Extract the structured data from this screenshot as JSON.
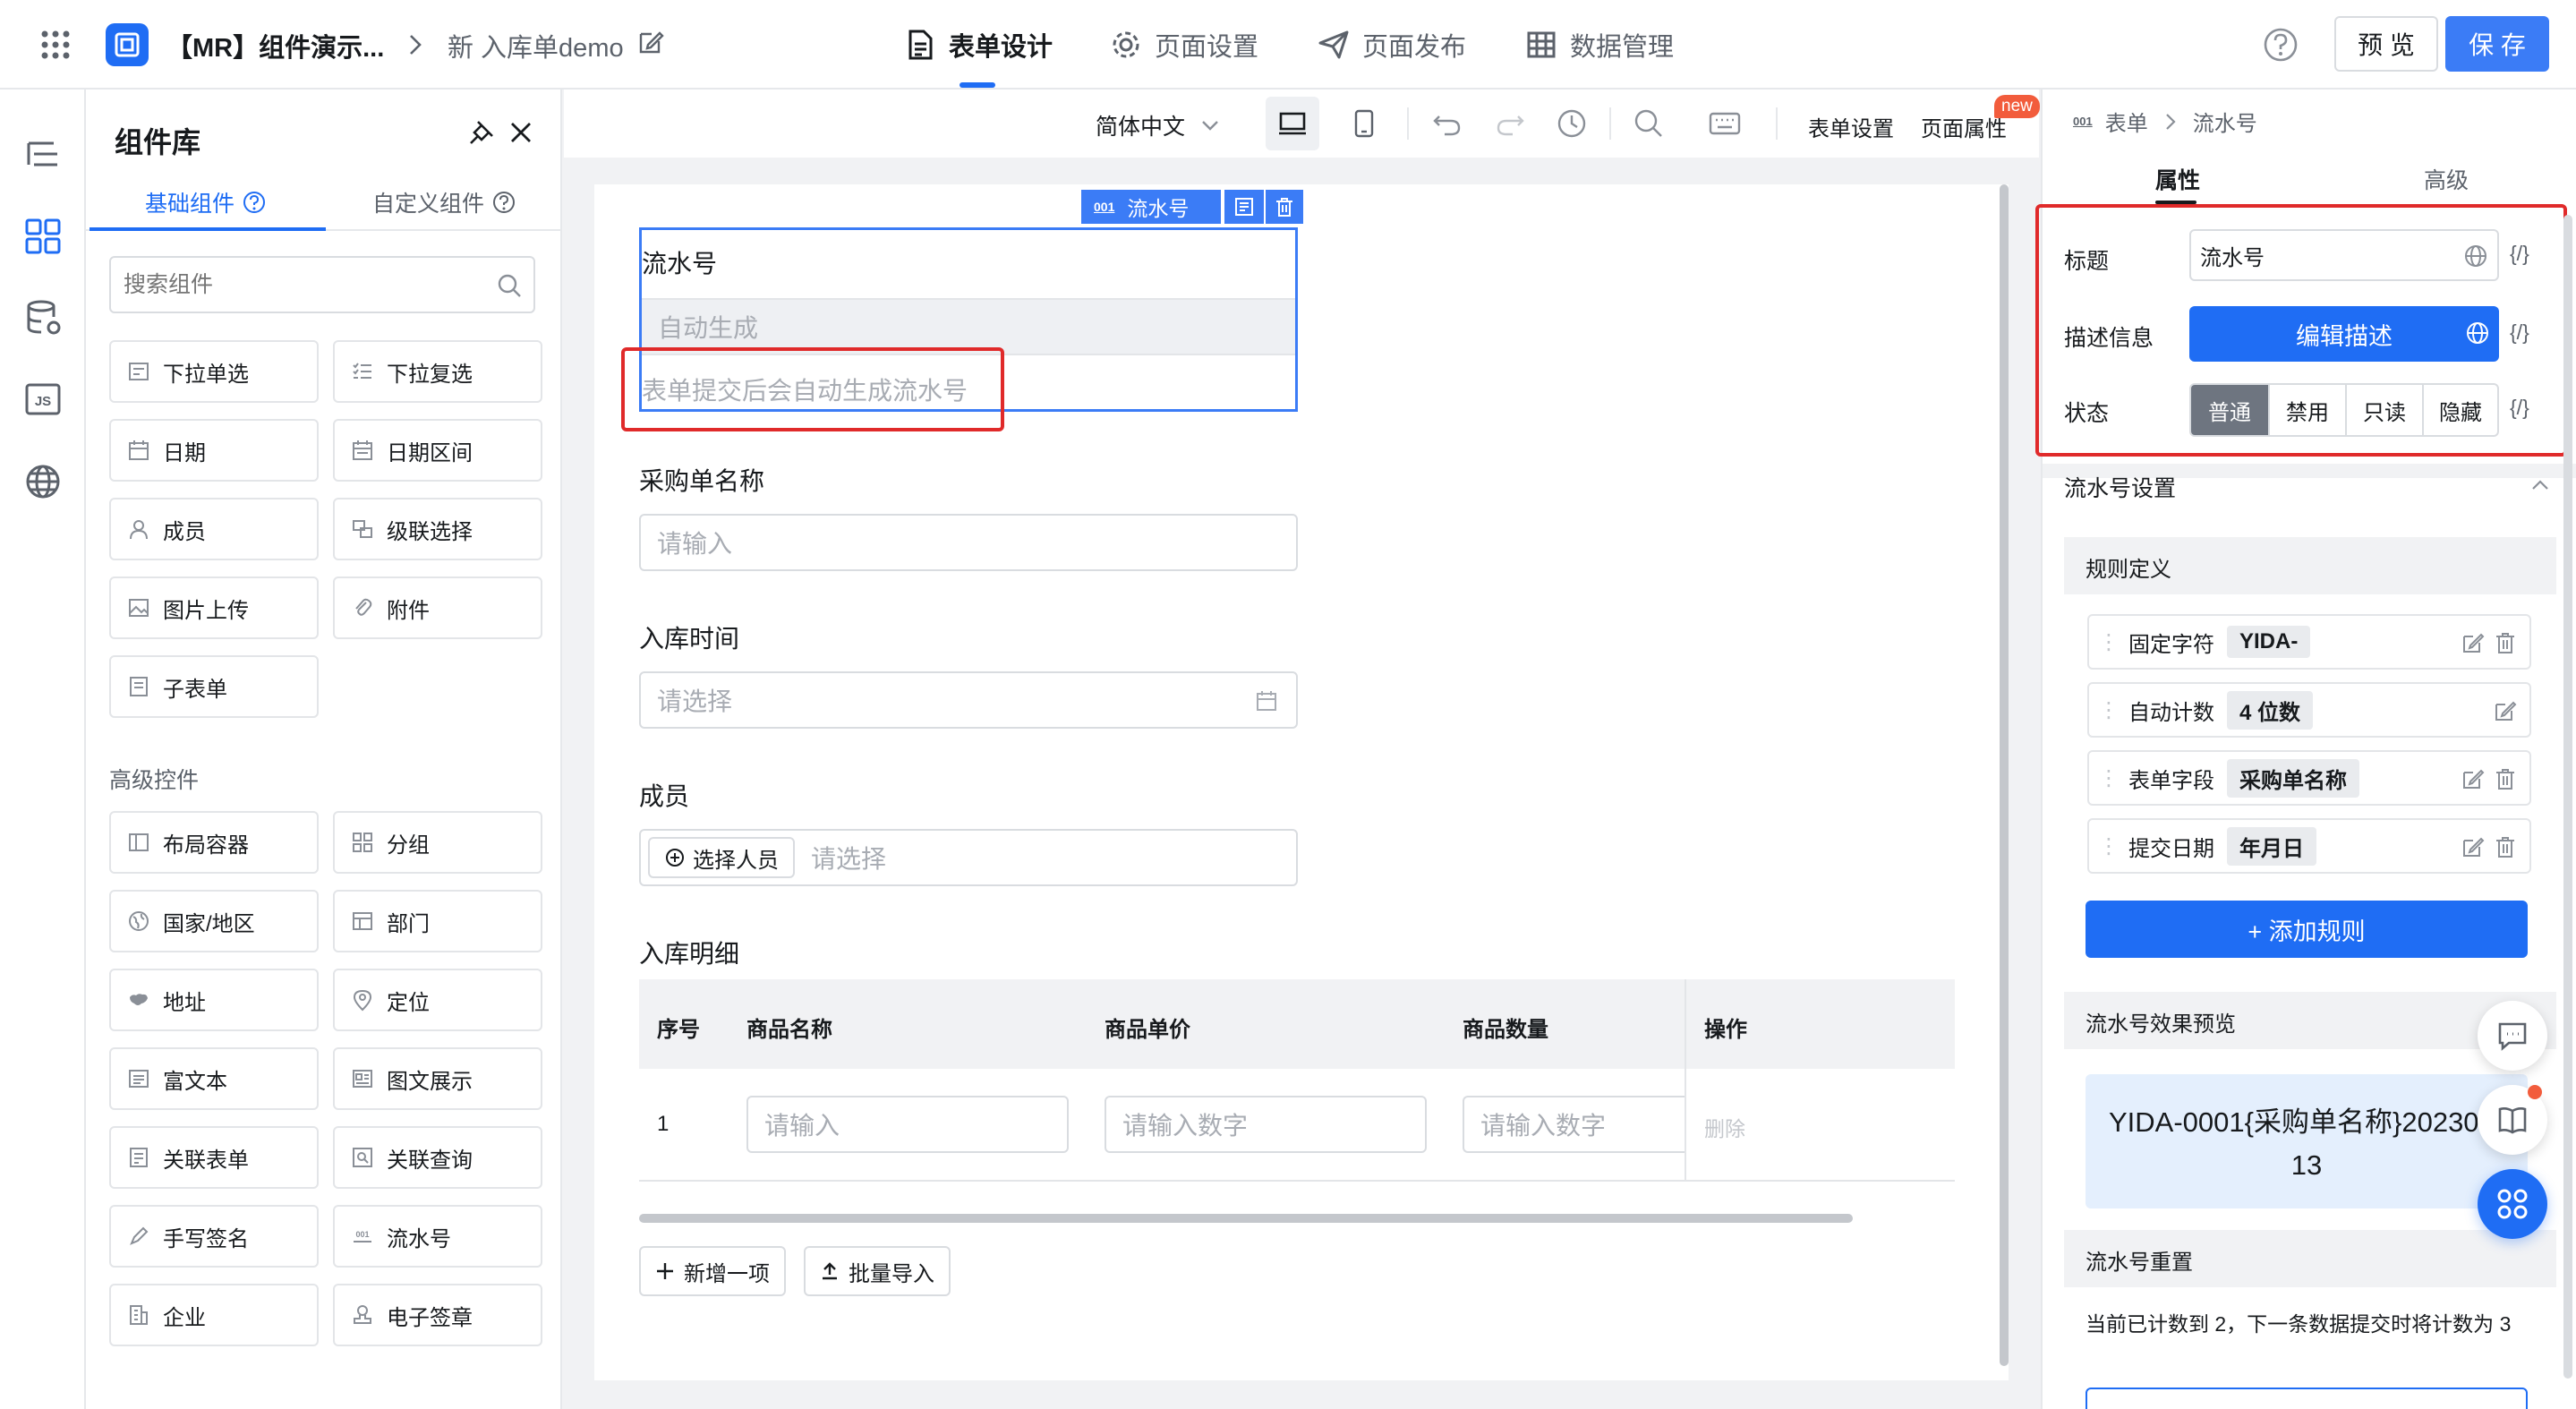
{
  "header": {
    "app_name": "【MR】组件演示...",
    "page_name": "新 入库单demo",
    "tabs": [
      {
        "label": "表单设计"
      },
      {
        "label": "页面设置"
      },
      {
        "label": "页面发布"
      },
      {
        "label": "数据管理"
      }
    ],
    "preview_label": "预 览",
    "save_label": "保 存"
  },
  "component_panel": {
    "title": "组件库",
    "tabs": [
      {
        "label": "基础组件"
      },
      {
        "label": "自定义组件"
      }
    ],
    "search_placeholder": "搜索组件",
    "basic_items": [
      "下拉单选",
      "下拉复选",
      "日期",
      "日期区间",
      "成员",
      "级联选择",
      "图片上传",
      "附件",
      "子表单"
    ],
    "advanced_title": "高级控件",
    "advanced_items": [
      "布局容器",
      "分组",
      "国家/地区",
      "部门",
      "地址",
      "定位",
      "富文本",
      "图文展示",
      "关联表单",
      "关联查询",
      "手写签名",
      "流水号",
      "企业",
      "电子签章"
    ]
  },
  "canvas_toolbar": {
    "language": "简体中文",
    "form_settings": "表单设置",
    "page_props": "页面属性",
    "new_badge": "new"
  },
  "form": {
    "selected_tag": "流水号",
    "selected_tag_icon": "001",
    "serial": {
      "label": "流水号",
      "value": "自动生成",
      "hint": "表单提交后会自动生成流水号"
    },
    "purchase": {
      "label": "采购单名称",
      "placeholder": "请输入"
    },
    "time": {
      "label": "入库时间",
      "placeholder": "请选择"
    },
    "member": {
      "label": "成员",
      "button": "选择人员",
      "placeholder": "请选择"
    },
    "detail": {
      "label": "入库明细",
      "columns": [
        "序号",
        "商品名称",
        "商品单价",
        "商品数量",
        "操作"
      ],
      "row": {
        "index": "1",
        "name_ph": "请输入",
        "price_ph": "请输入数字",
        "qty_ph": "请输入数字",
        "action": "删除"
      },
      "add_button": "新增一项",
      "import_button": "批量导入"
    }
  },
  "props_panel": {
    "breadcrumb_icon": "001",
    "breadcrumb": [
      "表单",
      "流水号"
    ],
    "tabs": [
      {
        "label": "属性"
      },
      {
        "label": "高级"
      }
    ],
    "title_label": "标题",
    "title_value": "流水号",
    "desc_label": "描述信息",
    "desc_button": "编辑描述",
    "status_label": "状态",
    "status_options": [
      "普通",
      "禁用",
      "只读",
      "隐藏"
    ],
    "var_glyph": "{/}",
    "serial_settings": "流水号设置",
    "rule_def": "规则定义",
    "rules": [
      {
        "name": "固定字符",
        "value": "YIDA-"
      },
      {
        "name": "自动计数",
        "value": "4 位数"
      },
      {
        "name": "表单字段",
        "value": "采购单名称"
      },
      {
        "name": "提交日期",
        "value": "年月日"
      }
    ],
    "add_rule": "+ 添加规则",
    "preview_title": "流水号效果预览",
    "preview_line1": "YIDA-0001{采购单名称}20230",
    "preview_line2": "13",
    "reset_title": "流水号重置",
    "reset_text": "当前已计数到 2，下一条数据提交时将计数为 3"
  },
  "colors": {
    "primary": "#1f6df4",
    "highlight_red": "#e02a2a",
    "selected_blue": "#3b7cf6"
  }
}
